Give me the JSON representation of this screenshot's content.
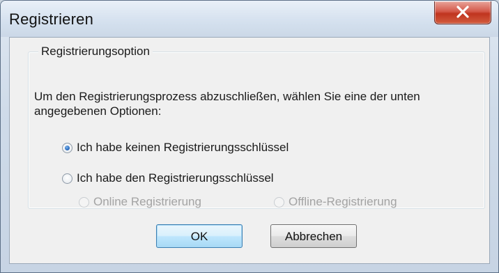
{
  "window": {
    "title": "Registrieren",
    "close_icon": "close-icon"
  },
  "group": {
    "legend": "Registrierungsoption",
    "description": "Um den Registrierungsprozess abzuschließen, wählen Sie eine der unten angegebenen Optionen:",
    "options": [
      {
        "label": "Ich habe keinen Registrierungsschlüssel",
        "checked": true,
        "enabled": true
      },
      {
        "label": "Ich habe den Registrierungsschlüssel",
        "checked": false,
        "enabled": true
      }
    ],
    "sub_options": [
      {
        "label": "Online  Registrierung",
        "checked": false,
        "enabled": false
      },
      {
        "label": "Offline-Registrierung",
        "checked": false,
        "enabled": false
      }
    ]
  },
  "buttons": {
    "ok": "OK",
    "cancel": "Abbrechen"
  },
  "colors": {
    "close_button": "#c9402b",
    "default_button_border": "#3c7fb1",
    "disabled_text": "#a3a3a3"
  }
}
